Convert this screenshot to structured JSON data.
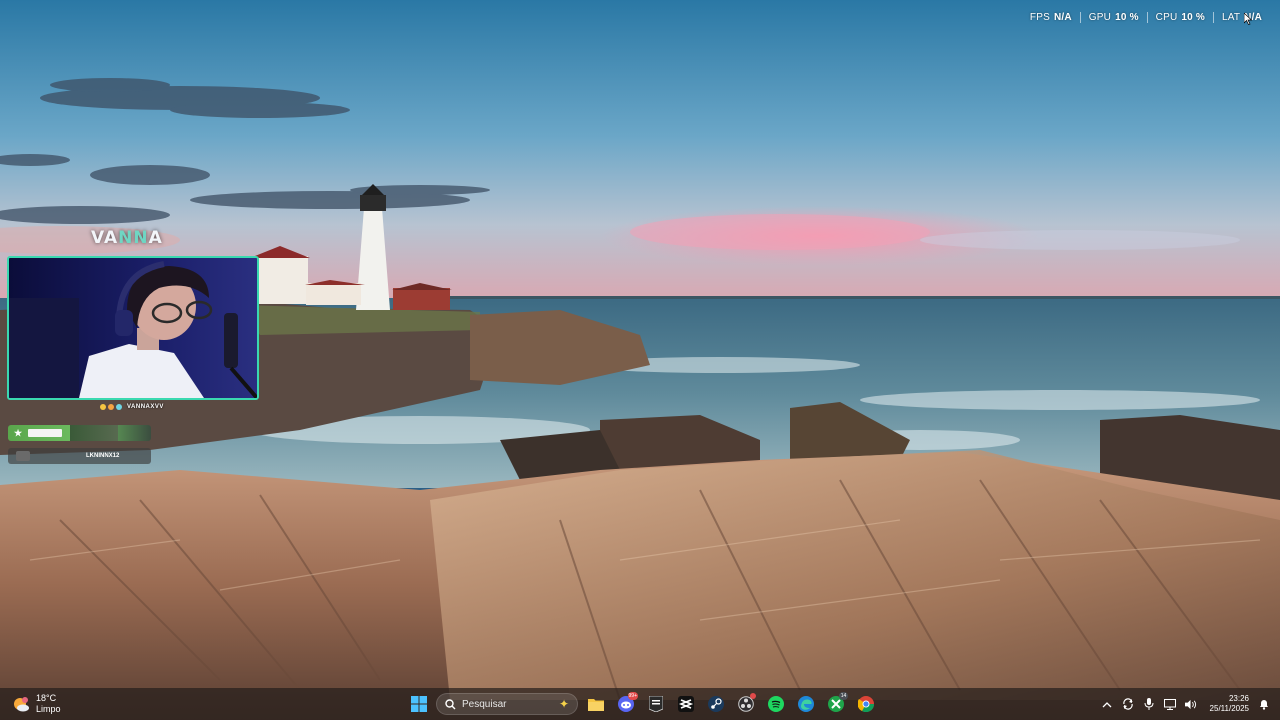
{
  "perf_overlay": {
    "fps": {
      "label": "FPS",
      "value": "N/A"
    },
    "gpu": {
      "label": "GPU",
      "value": "10 %"
    },
    "cpu": {
      "label": "CPU",
      "value": "10 %"
    },
    "lat": {
      "label": "LAT",
      "value": "N/A"
    }
  },
  "stream_overlay": {
    "brand_logo_prefix": "VA",
    "brand_logo_accent": "NN",
    "brand_logo_suffix": "A",
    "channel_handle": "VANNAXVV",
    "events": [
      {
        "label": ""
      },
      {
        "label": "LKNINNX12"
      }
    ]
  },
  "taskbar": {
    "weather": {
      "temperature": "18°C",
      "condition": "Limpo",
      "icon": "sun-cloud-icon"
    },
    "search": {
      "placeholder": "Pesquisar",
      "icon": "search-icon"
    },
    "apps": [
      {
        "name": "file-explorer",
        "icon": "folder-icon",
        "badge": ""
      },
      {
        "name": "discord",
        "icon": "discord-icon",
        "badge": "99+"
      },
      {
        "name": "epic-games",
        "icon": "epic-games-icon",
        "badge": ""
      },
      {
        "name": "capcut",
        "icon": "capcut-icon",
        "badge": ""
      },
      {
        "name": "steam",
        "icon": "steam-icon",
        "badge": ""
      },
      {
        "name": "obs",
        "icon": "obs-icon",
        "badge": ""
      },
      {
        "name": "spotify",
        "icon": "spotify-icon",
        "badge": ""
      },
      {
        "name": "edge",
        "icon": "edge-icon",
        "badge": ""
      },
      {
        "name": "xbox",
        "icon": "xbox-icon",
        "badge": "14"
      },
      {
        "name": "chrome",
        "icon": "chrome-icon",
        "badge": ""
      }
    ],
    "tray": {
      "icons": [
        "chevron-up-icon",
        "sync-icon",
        "microphone-icon",
        "display-icon",
        "volume-icon"
      ],
      "time": "23:26",
      "date": "25/11/2025"
    }
  },
  "colors": {
    "accent_webcam_border": "#3ad9b0",
    "event_green": "#5aa64c"
  }
}
